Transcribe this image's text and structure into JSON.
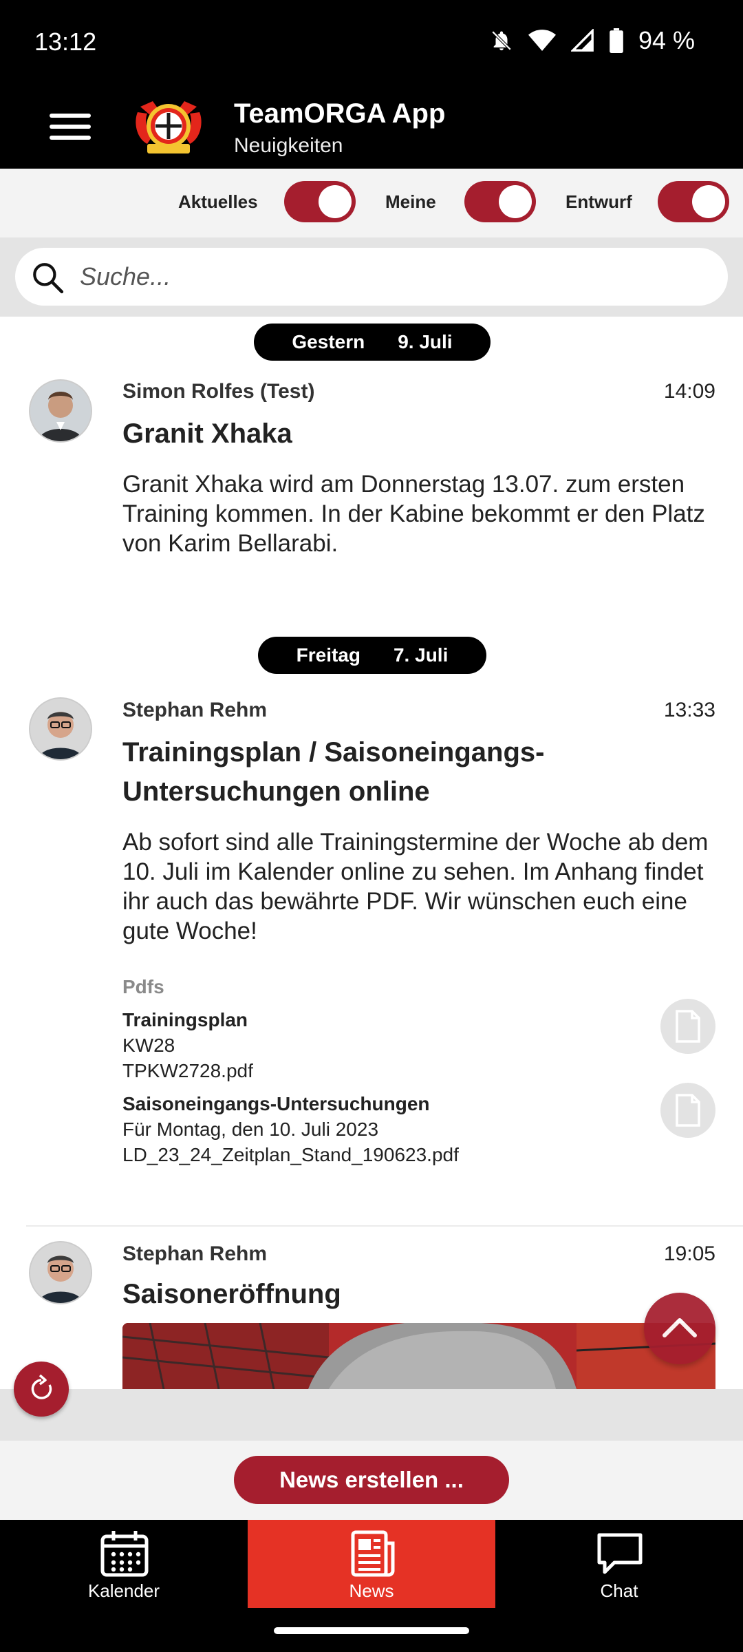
{
  "status_bar": {
    "time": "13:12",
    "battery": "94 %"
  },
  "app_bar": {
    "title": "TeamORGA App",
    "subtitle": "Neuigkeiten",
    "logo_text": "BAYER Leverkusen 1904"
  },
  "filters": [
    {
      "label": "Aktuelles",
      "on": true
    },
    {
      "label": "Meine",
      "on": true
    },
    {
      "label": "Entwurf",
      "on": true
    }
  ],
  "search": {
    "placeholder": "Suche..."
  },
  "feed": {
    "groups": [
      {
        "day": "Gestern",
        "date": "9. Juli"
      },
      {
        "day": "Freitag",
        "date": "7. Juli"
      }
    ],
    "posts": [
      {
        "author": "Simon Rolfes (Test)",
        "time": "14:09",
        "title": "Granit Xhaka",
        "body": "Granit Xhaka wird am Donnerstag 13.07. zum ersten Training kommen. In der Kabine bekommt er den Platz von Karim Bellarabi."
      },
      {
        "author": "Stephan Rehm",
        "time": "13:33",
        "title": "Trainingsplan / Saisoneingangs-Untersuchungen online",
        "body": "Ab sofort sind alle Trainingstermine der Woche ab dem 10. Juli im Kalender online zu sehen. Im Anhang findet ihr auch das bewährte PDF. Wir wünschen euch eine gute Woche!",
        "attachments_heading": "Pdfs",
        "attachments": [
          {
            "title": "Trainingsplan",
            "desc": "KW28",
            "file": "TPKW2728.pdf"
          },
          {
            "title": "Saisoneingangs-Untersuchungen",
            "desc": "Für Montag, den 10. Juli 2023",
            "file": "LD_23_24_Zeitplan_Stand_190623.pdf"
          }
        ]
      },
      {
        "author": "Stephan Rehm",
        "time": "19:05",
        "title": "Saisoneröffnung"
      }
    ]
  },
  "create_button": "News erstellen ...",
  "bottom_nav": [
    {
      "label": "Kalender",
      "icon": "calendar-icon",
      "active": false
    },
    {
      "label": "News",
      "icon": "newspaper-icon",
      "active": true
    },
    {
      "label": "Chat",
      "icon": "chat-bubble-icon",
      "active": false
    }
  ],
  "colors": {
    "brand": "#a51e2e",
    "nav_active": "#e53225",
    "bar": "#000000"
  }
}
